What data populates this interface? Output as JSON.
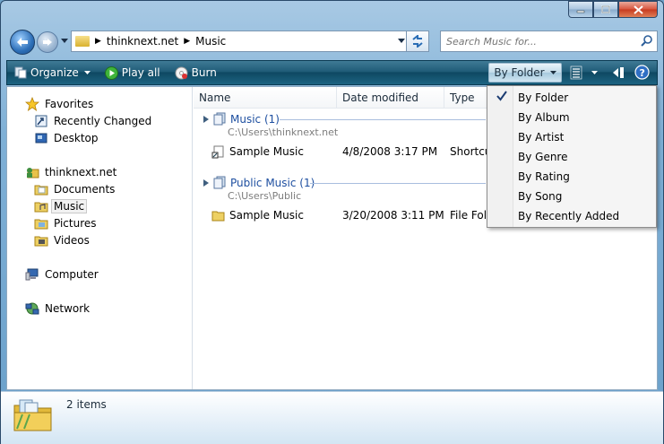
{
  "address": {
    "crumbs": [
      "thinknext.net",
      "Music"
    ]
  },
  "search": {
    "placeholder": "Search Music for..."
  },
  "toolbar": {
    "organize_label": "Organize",
    "playall_label": "Play all",
    "burn_label": "Burn",
    "view_label": "By Folder"
  },
  "nav": {
    "favorites_label": "Favorites",
    "favorites": [
      "Recently Changed",
      "Desktop"
    ],
    "user_label": "thinknext.net",
    "user_folders": [
      "Documents",
      "Music",
      "Pictures",
      "Videos"
    ],
    "computer_label": "Computer",
    "network_label": "Network",
    "selected": "Music"
  },
  "columns": [
    "Name",
    "Date modified",
    "Type"
  ],
  "groups": [
    {
      "title": "Music (1)",
      "path": "C:\\Users\\thinknext.net",
      "item": {
        "name": "Sample Music",
        "date": "4/8/2008 3:17 PM",
        "type": "Shortcu"
      }
    },
    {
      "title": "Public Music (1)",
      "path": "C:\\Users\\Public",
      "item": {
        "name": "Sample Music",
        "date": "3/20/2008 3:11 PM",
        "type": "File Folc"
      }
    }
  ],
  "view_menu": {
    "items": [
      "By Folder",
      "By Album",
      "By Artist",
      "By Genre",
      "By Rating",
      "By Song",
      "By Recently Added"
    ],
    "checked": "By Folder"
  },
  "details": {
    "count_text": "2 items"
  },
  "colors": {
    "command_bar": "#205c78",
    "group_header": "#1e4fa0",
    "path_text": "#7d7d7d"
  }
}
